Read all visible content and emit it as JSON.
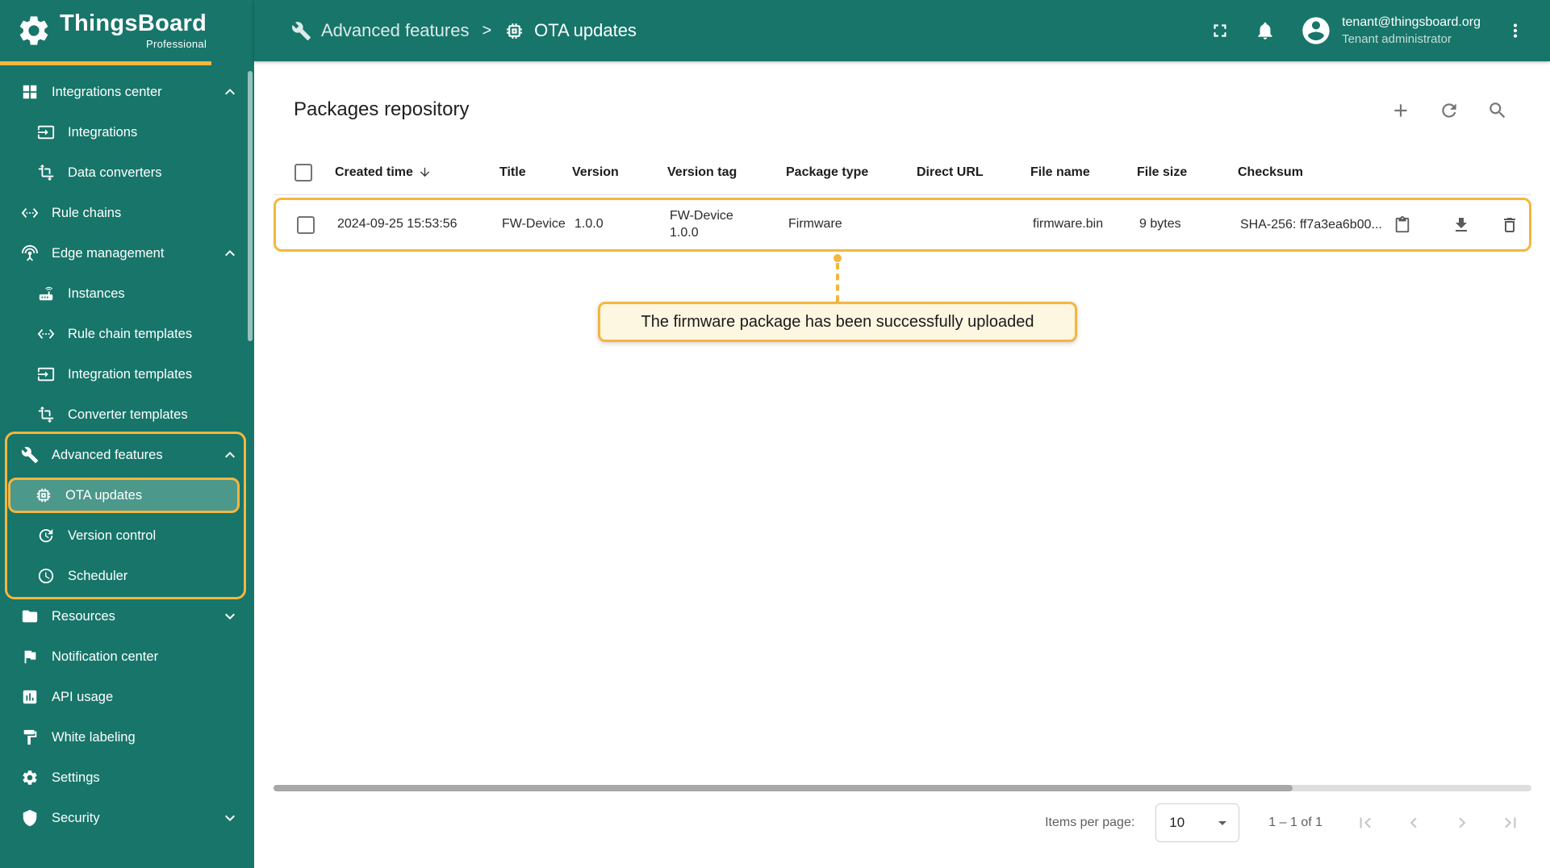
{
  "app": {
    "brand": "ThingsBoard",
    "brand_sub": "Professional"
  },
  "header": {
    "breadcrumb": [
      {
        "label": "Advanced features",
        "icon": "tools-icon"
      },
      {
        "label": "OTA updates",
        "icon": "memory-chip-icon"
      }
    ],
    "separator": ">",
    "user": {
      "email": "tenant@thingsboard.org",
      "role": "Tenant administrator"
    }
  },
  "sidebar": {
    "items": [
      {
        "label": "Integrations center",
        "icon": "grid-icon",
        "expanded": true
      },
      {
        "label": "Integrations",
        "icon": "input-icon"
      },
      {
        "label": "Data converters",
        "icon": "transform-icon"
      },
      {
        "label": "Rule chains",
        "icon": "ethernet-icon"
      },
      {
        "label": "Edge management",
        "icon": "antenna-icon",
        "expanded": true
      },
      {
        "label": "Instances",
        "icon": "router-icon"
      },
      {
        "label": "Rule chain templates",
        "icon": "ethernet-icon"
      },
      {
        "label": "Integration templates",
        "icon": "input-icon"
      },
      {
        "label": "Converter templates",
        "icon": "transform-icon"
      },
      {
        "label": "Advanced features",
        "icon": "tools-icon",
        "expanded": true
      },
      {
        "label": "OTA updates",
        "icon": "memory-chip-icon",
        "active": true
      },
      {
        "label": "Version control",
        "icon": "update-icon"
      },
      {
        "label": "Scheduler",
        "icon": "clock-icon"
      },
      {
        "label": "Resources",
        "icon": "folder-icon",
        "expanded": false
      },
      {
        "label": "Notification center",
        "icon": "flag-icon"
      },
      {
        "label": "API usage",
        "icon": "chart-icon"
      },
      {
        "label": "White labeling",
        "icon": "paint-icon"
      },
      {
        "label": "Settings",
        "icon": "gear-icon"
      },
      {
        "label": "Security",
        "icon": "shield-icon",
        "expanded": false
      }
    ]
  },
  "main": {
    "title": "Packages repository",
    "table": {
      "columns": [
        "Created time",
        "Title",
        "Version",
        "Version tag",
        "Package type",
        "Direct URL",
        "File name",
        "File size",
        "Checksum"
      ],
      "rows": [
        {
          "created_time": "2024-09-25 15:53:56",
          "title": "FW-Device",
          "version": "1.0.0",
          "version_tag": "FW-Device 1.0.0",
          "package_type": "Firmware",
          "direct_url": "",
          "file_name": "firmware.bin",
          "file_size": "9 bytes",
          "checksum": "SHA-256: ff7a3ea6b00..."
        }
      ]
    },
    "annotation": {
      "text": "The firmware package has been successfully uploaded"
    },
    "pagination": {
      "items_per_page_label": "Items per page:",
      "items_per_page": "10",
      "range": "1 – 1 of 1"
    }
  },
  "colors": {
    "teal": "#17756A",
    "accent_yellow": "#F4B63F",
    "active_item_bg": "#4C988B",
    "callout_bg": "#FDF6E0"
  }
}
